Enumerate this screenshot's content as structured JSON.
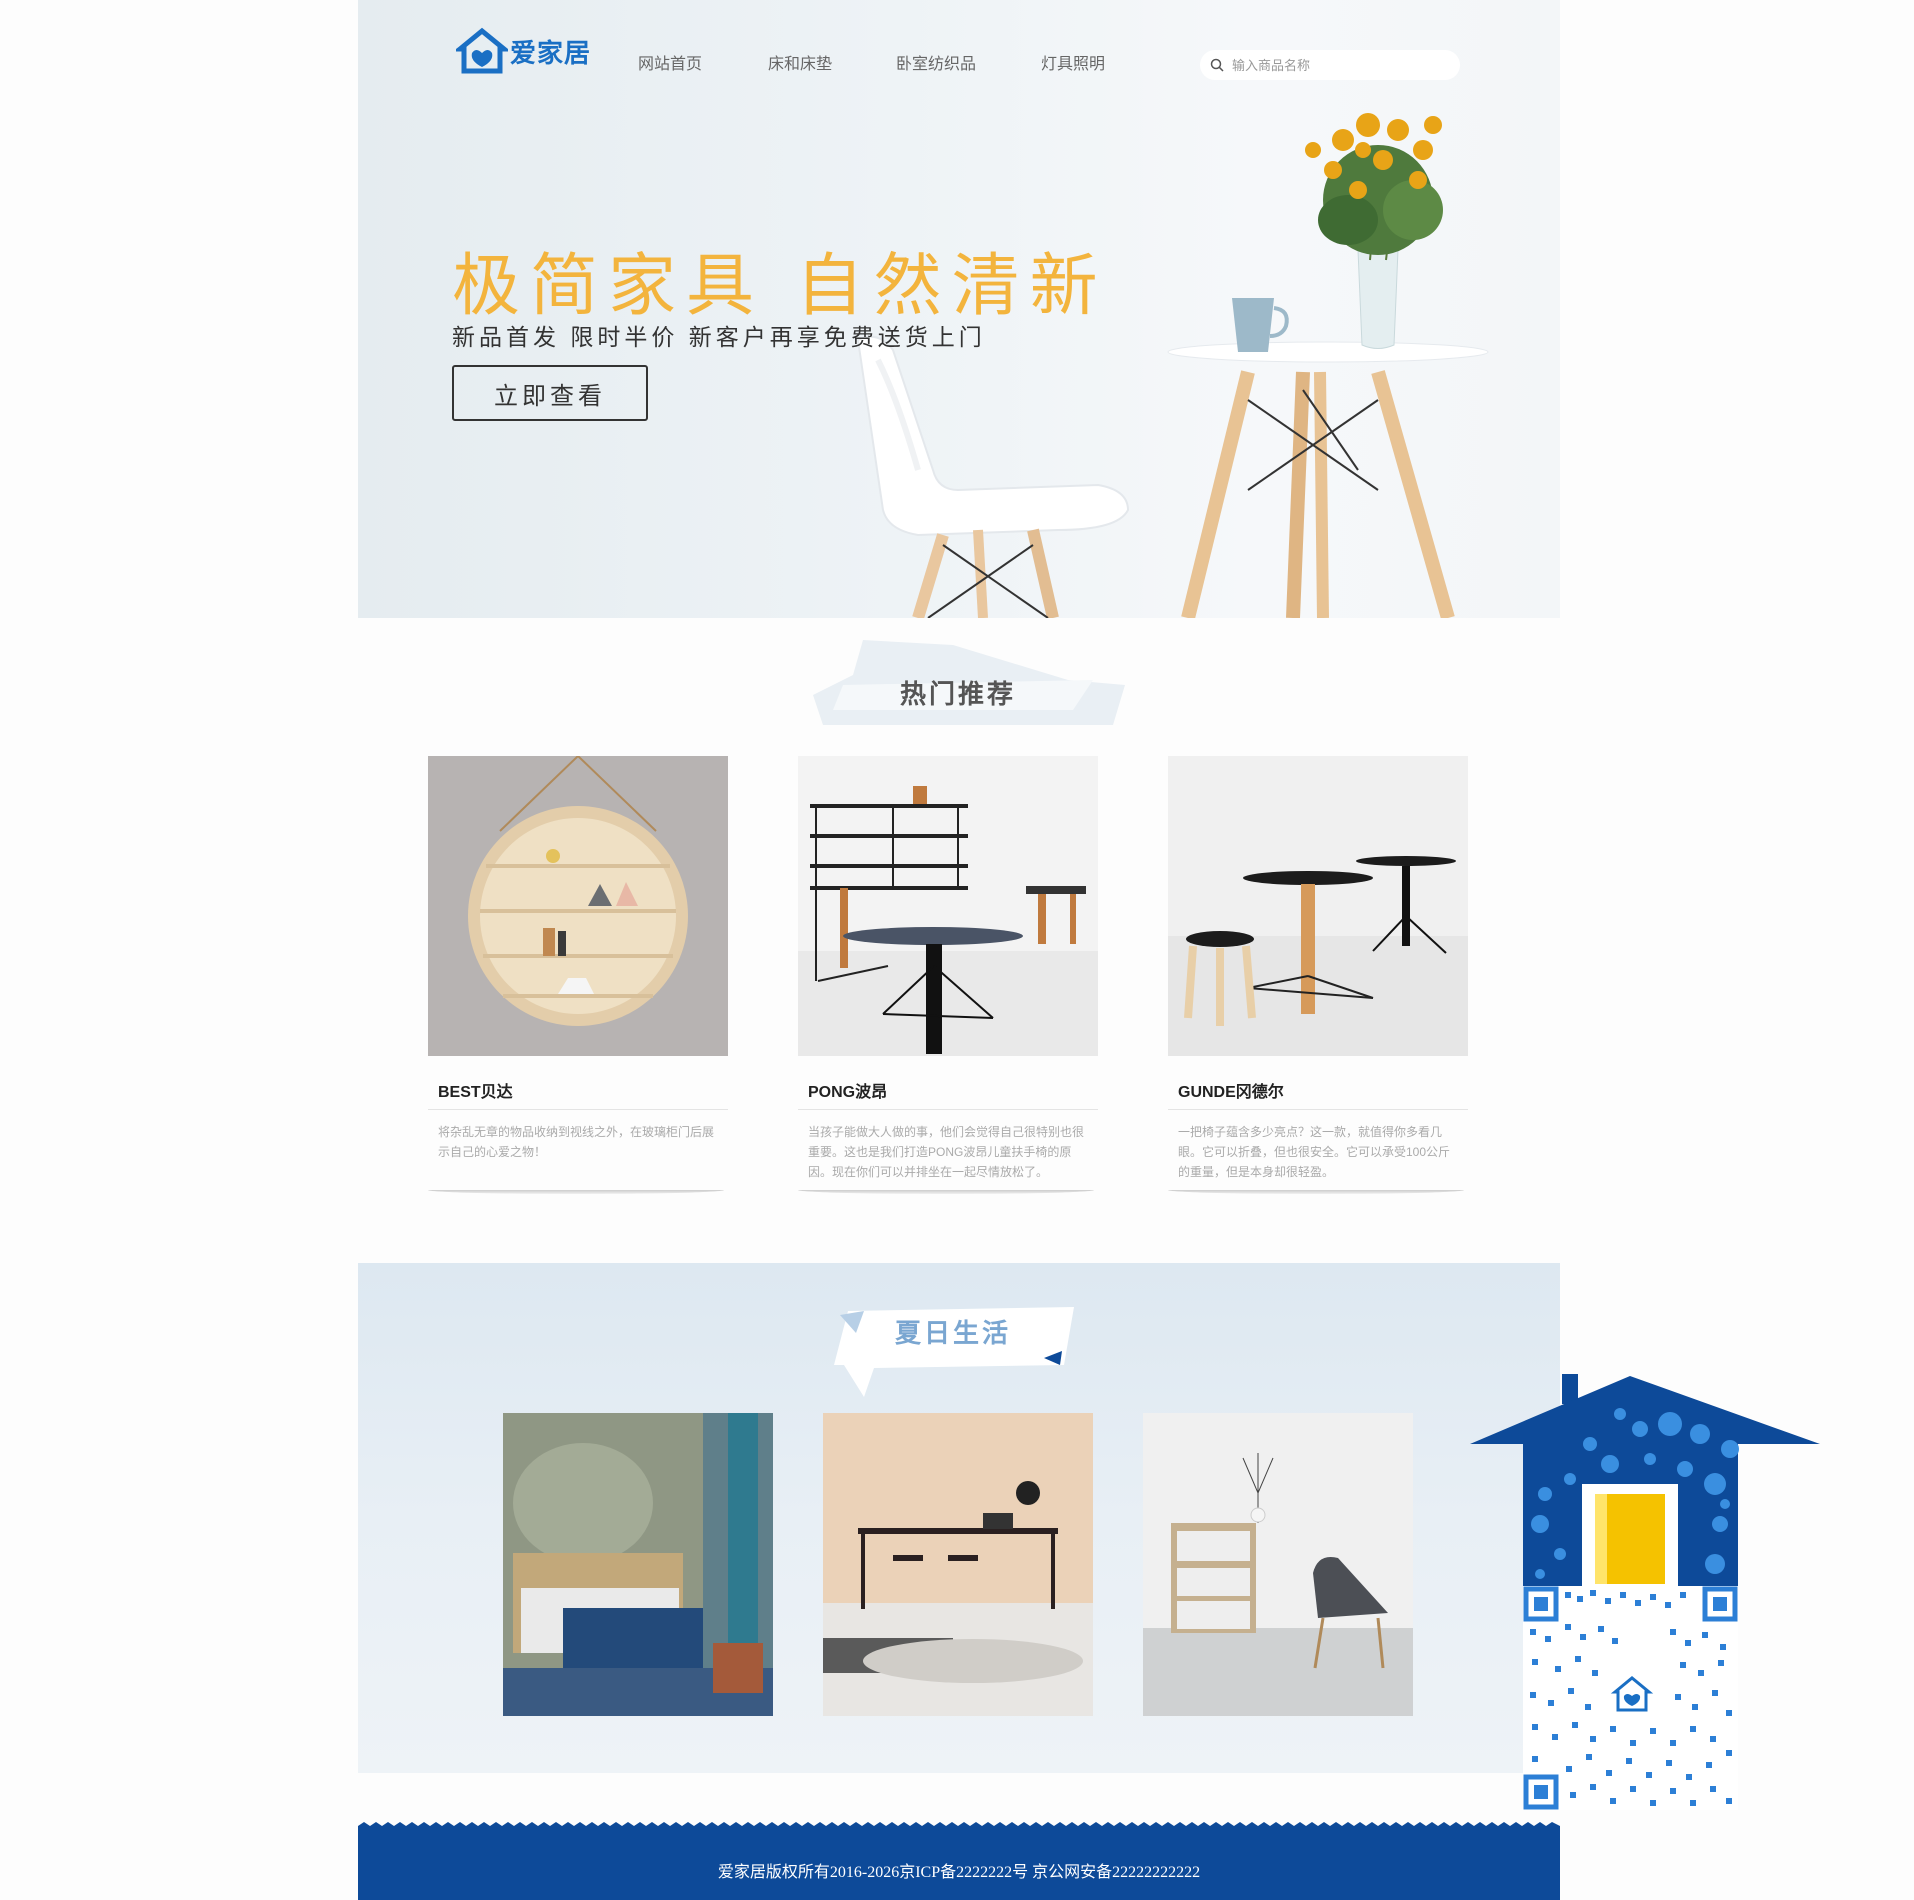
{
  "brand": {
    "name": "爱家居",
    "color": "#1a6fc4"
  },
  "nav": {
    "items": [
      "网站首页",
      "床和床垫",
      "卧室纺织品",
      "灯具照明"
    ]
  },
  "search": {
    "placeholder": "输入商品名称",
    "icon": "search-icon"
  },
  "hero": {
    "title": "极简家具 自然清新",
    "subtitle": "新品首发  限时半价  新客户再享免费送货上门",
    "button": "立即查看",
    "title_color": "#f3b43d"
  },
  "hot": {
    "title": "热门推荐",
    "products": [
      {
        "name": "BEST贝达",
        "desc": "将杂乱无章的物品收纳到视线之外，在玻璃柜门后展示自己的心爱之物！"
      },
      {
        "name": "PONG波昂",
        "desc": "当孩子能做大人做的事，他们会觉得自己很特别也很重要。这也是我们打造PONG波昂儿童扶手椅的原因。现在你们可以并排坐在一起尽情放松了。"
      },
      {
        "name": "GUNDE冈德尔",
        "desc": "一把椅子蕴含多少亮点？这一款，就值得你多看几眼。它可以折叠，但也很安全。它可以承受100公斤的重量，但是本身却很轻盈。"
      }
    ]
  },
  "summer": {
    "title": "夏日生活"
  },
  "footer": {
    "text": "爱家居版权所有2016-2026京ICP备2222222号   京公网安备22222222222",
    "color": "#0d4a99"
  }
}
